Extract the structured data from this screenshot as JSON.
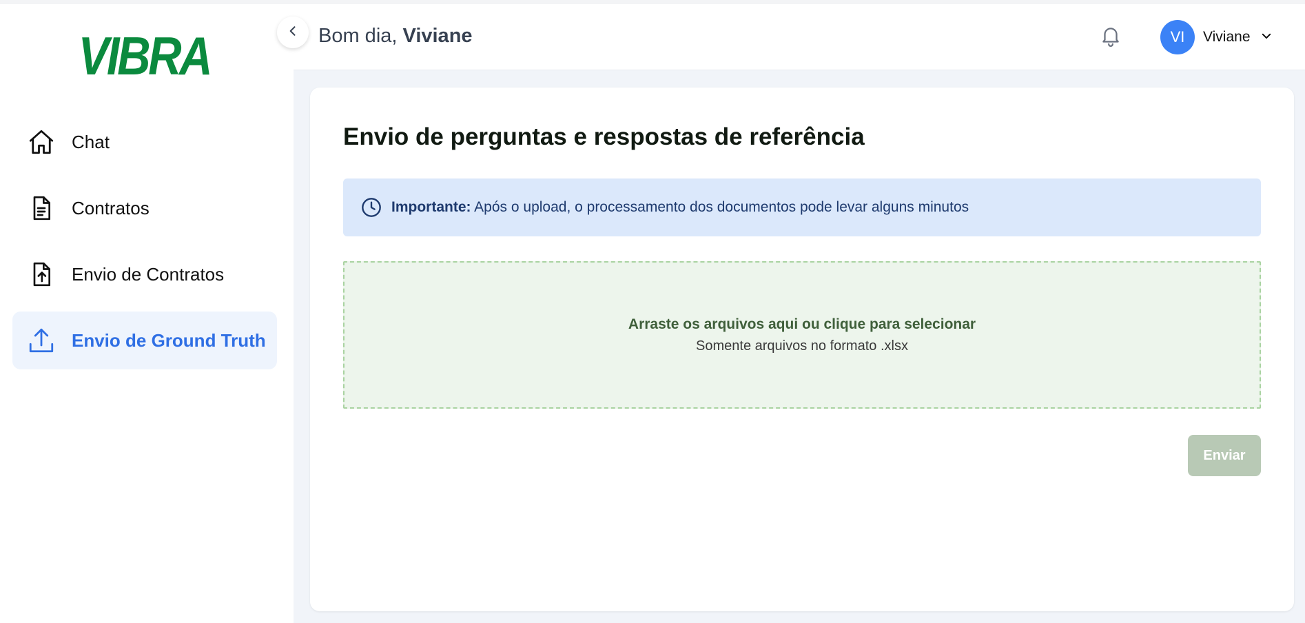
{
  "brand": {
    "logo_text": "VIBRA",
    "color": "#0b8a3e"
  },
  "sidebar": {
    "items": [
      {
        "label": "Chat",
        "icon": "home-icon",
        "active": false
      },
      {
        "label": "Contratos",
        "icon": "document-icon",
        "active": false
      },
      {
        "label": "Envio de Contratos",
        "icon": "file-upload-icon",
        "active": false
      },
      {
        "label": "Envio de Ground Truth",
        "icon": "upload-icon",
        "active": true
      }
    ]
  },
  "header": {
    "greeting_prefix": "Bom dia, ",
    "greeting_name": "Viviane",
    "user": {
      "initials": "VI",
      "name": "Viviane"
    }
  },
  "main": {
    "title": "Envio de perguntas e respostas de referência",
    "notice": {
      "label": "Importante:",
      "text": " Após o upload, o processamento dos documentos pode levar alguns minutos"
    },
    "dropzone": {
      "title": "Arraste os arquivos aqui ou clique para selecionar",
      "subtitle": "Somente arquivos no formato .xlsx"
    },
    "send_label": "Enviar"
  },
  "colors": {
    "accent": "#2f6fe4",
    "avatar": "#3b82f6",
    "notice_bg": "#dbe8fb",
    "dropzone_bg": "#edf5ec",
    "disabled_button": "#b8c9b5"
  }
}
